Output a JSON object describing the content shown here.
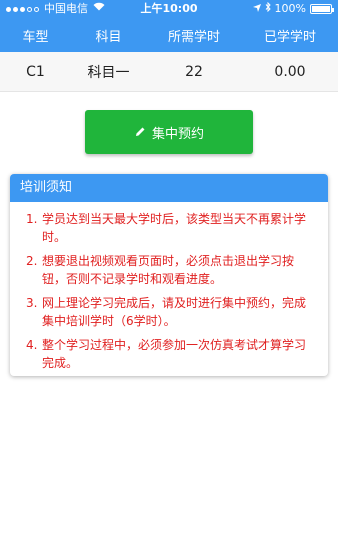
{
  "status_bar": {
    "carrier": "中国电信",
    "time": "上午10:00",
    "battery": "100%"
  },
  "table": {
    "headers": [
      "车型",
      "科目",
      "所需学时",
      "已学学时"
    ],
    "row": [
      "C1",
      "科目一",
      "22",
      "0.00"
    ]
  },
  "button": {
    "label": "集中预约",
    "icon": "pencil-icon"
  },
  "notice": {
    "title": "培训须知",
    "items": [
      {
        "num": "1.",
        "text": "学员达到当天最大学时后，该类型当天不再累计学时。"
      },
      {
        "num": "2.",
        "text": "想要退出视频观看页面时，必须点击退出学习按钮，否则不记录学时和观看进度。"
      },
      {
        "num": "3.",
        "text": "网上理论学习完成后，请及时进行集中预约，完成集中培训学时（6学时）。"
      },
      {
        "num": "4.",
        "text": "整个学习过程中，必须参加一次仿真考试才算学习完成。"
      }
    ]
  },
  "colors": {
    "primary": "#3d98f2",
    "button": "#20b53b",
    "notice_text": "#e02020"
  }
}
